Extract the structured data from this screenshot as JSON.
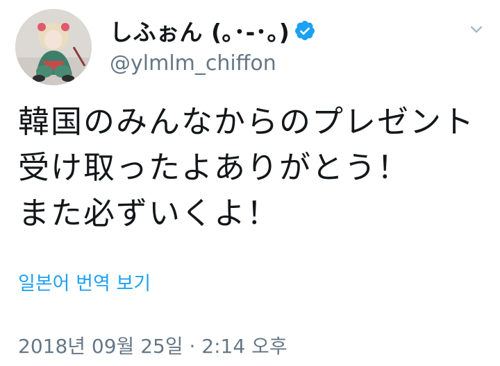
{
  "author": {
    "display_name": "しふぉん (｡･-･｡)",
    "handle": "@ylmlm_chiffon",
    "verified": true,
    "avatar_icon": "user-avatar"
  },
  "tweet": {
    "text": "韓国のみんなからのプレゼント受け取ったよありがとう！\nまた必ずいくよ！",
    "translate_label": "일본어 번역 보기",
    "timestamp": "2018년 09월 25일 · 2:14 오후"
  },
  "colors": {
    "link": "#1da1f2",
    "verified": "#1da1f2",
    "secondary_text": "#657786",
    "primary_text": "#14171a"
  },
  "icons": {
    "verified": "verified-badge-icon",
    "menu": "chevron-down-icon"
  }
}
